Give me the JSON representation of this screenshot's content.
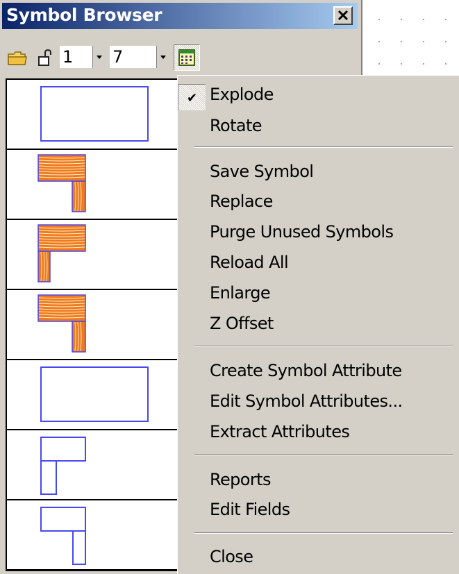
{
  "window": {
    "title": "Symbol Browser",
    "close_label": "×"
  },
  "toolbar": {
    "icons": [
      "folder-icon",
      "lock-icon",
      "calendar-icon"
    ],
    "spinner_1": "1",
    "spinner_2": "7"
  },
  "symbols": [
    {
      "kind": "rect-outline"
    },
    {
      "kind": "wood-L-right"
    },
    {
      "kind": "wood-L-left"
    },
    {
      "kind": "wood-L-right"
    },
    {
      "kind": "rect-outline"
    },
    {
      "kind": "outline-L-left"
    },
    {
      "kind": "outline-L-right"
    }
  ],
  "menu": {
    "explode": "Explode",
    "explode_checked": true,
    "rotate": "Rotate",
    "save_symbol": "Save Symbol",
    "replace": "Replace",
    "purge_unused": "Purge Unused Symbols",
    "reload_all": "Reload All",
    "enlarge": "Enlarge",
    "z_offset": "Z Offset",
    "create_attribute": "Create Symbol Attribute",
    "edit_attributes": "Edit Symbol Attributes...",
    "extract_attributes": "Extract Attributes",
    "reports": "Reports",
    "edit_fields": "Edit Fields",
    "close": "Close"
  },
  "colors": {
    "titlebar_start": "#0a246a",
    "titlebar_end": "#a6caf0",
    "panel": "#d4d0c8",
    "outline": "#4848f0",
    "wood": "#f07a1e"
  }
}
